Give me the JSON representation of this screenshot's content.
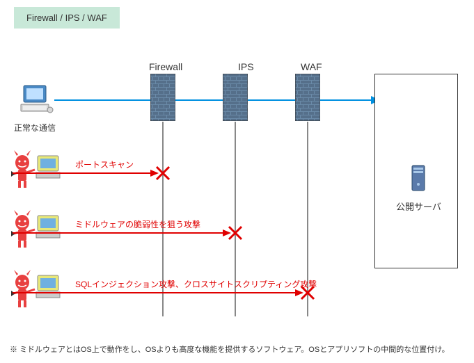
{
  "title": "Firewall / IPS /  WAF",
  "columns": {
    "firewall": "Firewall",
    "ips": "IPS",
    "waf": "WAF"
  },
  "normal_traffic_label": "正常な通信",
  "attacks": {
    "a1": "ポートスキャン",
    "a2": "ミドルウェアの脆弱性を狙う攻撃",
    "a3": "SQLインジェクション攻撃、クロスサイトスクリプティング攻撃"
  },
  "server_label": "公開サーバ",
  "footnote": "※  ミドルウェアとはOS上で動作をし、OSよりも高度な機能を提供するソフトウェア。OSとアプリソフトの中間的な位置付け。",
  "colors": {
    "title_bg": "#c8e8d8",
    "normal_arrow": "#0090e0",
    "attack_arrow": "#e00000",
    "cross": "#e00000"
  }
}
